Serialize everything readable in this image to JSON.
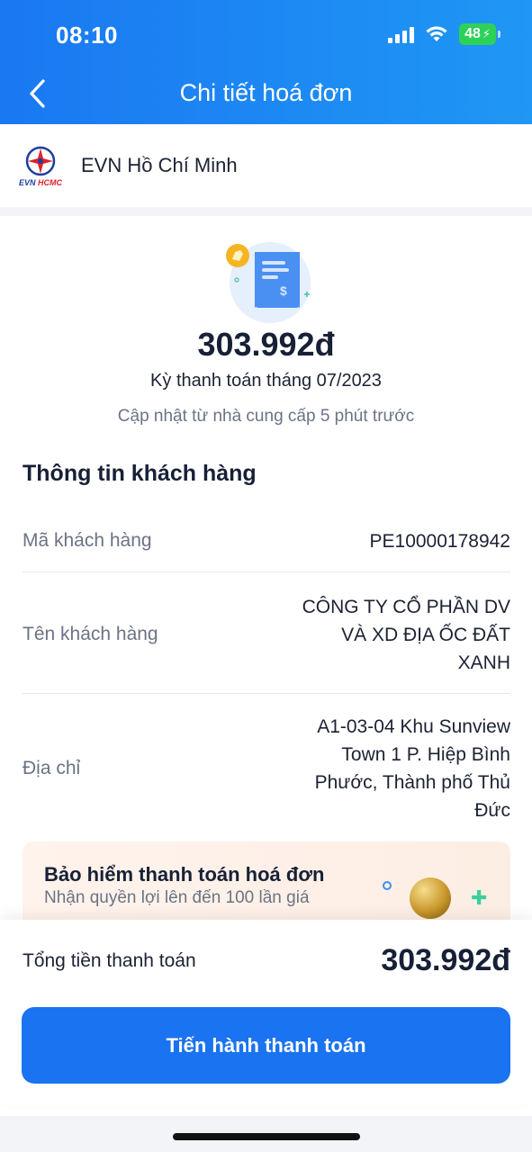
{
  "status_bar": {
    "time": "08:10",
    "battery": "48"
  },
  "header": {
    "title": "Chi tiết hoá đơn"
  },
  "provider": {
    "logo_text": "EVN",
    "logo_sub_a": "EVN",
    "logo_sub_b": "HCMC",
    "name": "EVN Hồ Chí Minh"
  },
  "bill": {
    "amount": "303.992đ",
    "period": "Kỳ thanh toán tháng 07/2023",
    "updated": "Cập nhật từ nhà cung cấp 5 phút trước"
  },
  "customer": {
    "section_title": "Thông tin khách hàng",
    "rows": [
      {
        "label": "Mã khách hàng",
        "value": "PE10000178942"
      },
      {
        "label": "Tên khách hàng",
        "value_lines": [
          "CÔNG TY CỔ PHẦN DV",
          "VÀ XD ĐỊA ỐC ĐẤT",
          "XANH"
        ]
      },
      {
        "label": "Địa chỉ",
        "value_lines": [
          "A1-03-04 Khu Sunview",
          "Town 1 P. Hiệp Bình",
          "Phước, Thành phố Thủ",
          "Đức"
        ]
      }
    ]
  },
  "promo": {
    "title": "Bảo hiểm thanh toán hoá đơn",
    "subtitle": "Nhận quyền lợi lên đến 100 lần giá"
  },
  "footer": {
    "total_label": "Tổng tiền thanh toán",
    "total_value": "303.992đ",
    "pay_button": "Tiến hành thanh toán"
  },
  "colors": {
    "primary": "#1a73f0",
    "header": "#1f8af3",
    "battery": "#2ed158"
  },
  "icons": [
    "back-chevron-icon",
    "signal-icon",
    "wifi-icon",
    "battery-icon",
    "evn-logo",
    "bill-icon",
    "globe-icon"
  ]
}
